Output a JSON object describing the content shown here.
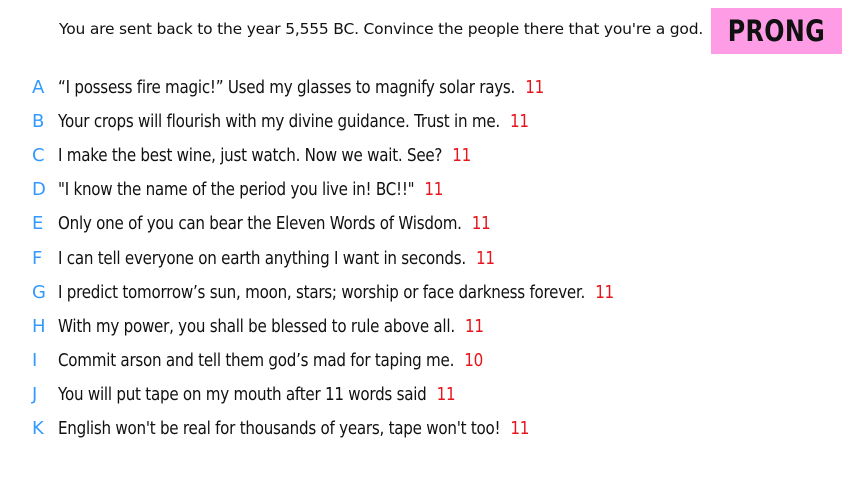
{
  "prompt": "You are sent back to the year 5,555 BC. Convince the people there that you're a god.",
  "logo": "PRONG",
  "colors": {
    "letter": "#3399ff",
    "count": "#e8141b",
    "logo_background": "#ff9ce6"
  },
  "answers": [
    {
      "letter": "A",
      "text": "“I possess fire magic!” Used my glasses to magnify solar rays.",
      "count": "11"
    },
    {
      "letter": "B",
      "text": "Your crops will flourish with my divine guidance. Trust in me.",
      "count": "11"
    },
    {
      "letter": "C",
      "text": "I make the best wine, just watch. Now we wait. See?",
      "count": "11"
    },
    {
      "letter": "D",
      "text": "\"I know the name of the period you live in! BC!!\"",
      "count": "11"
    },
    {
      "letter": "E",
      "text": "Only one of you can bear the Eleven Words of Wisdom.",
      "count": "11"
    },
    {
      "letter": "F",
      "text": "I can tell everyone on earth anything I want in seconds.",
      "count": "11"
    },
    {
      "letter": "G",
      "text": "I predict tomorrow’s sun, moon, stars; worship or face darkness forever.",
      "count": "11"
    },
    {
      "letter": "H",
      "text": "With my power, you shall be blessed to rule above all.",
      "count": "11"
    },
    {
      "letter": "I",
      "text": "Commit arson and tell them god’s mad for taping me.",
      "count": "10"
    },
    {
      "letter": "J",
      "text": "You will put tape on my mouth after 11 words said",
      "count": "11"
    },
    {
      "letter": "K",
      "text": "English won't be real for thousands of years, tape won't too!",
      "count": "11"
    }
  ]
}
